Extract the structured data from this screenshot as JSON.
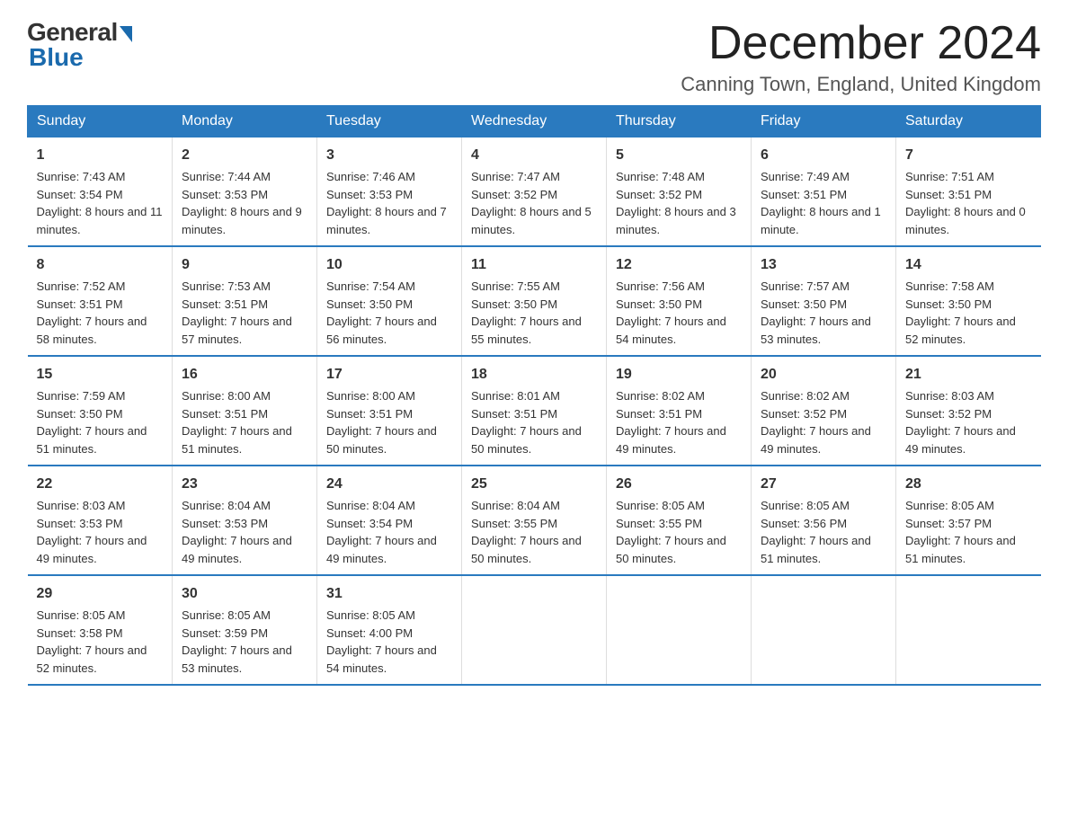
{
  "logo": {
    "general": "General",
    "blue": "Blue"
  },
  "title": "December 2024",
  "subtitle": "Canning Town, England, United Kingdom",
  "weekdays": [
    "Sunday",
    "Monday",
    "Tuesday",
    "Wednesday",
    "Thursday",
    "Friday",
    "Saturday"
  ],
  "weeks": [
    [
      {
        "day": "1",
        "sunrise": "7:43 AM",
        "sunset": "3:54 PM",
        "daylight": "8 hours and 11 minutes."
      },
      {
        "day": "2",
        "sunrise": "7:44 AM",
        "sunset": "3:53 PM",
        "daylight": "8 hours and 9 minutes."
      },
      {
        "day": "3",
        "sunrise": "7:46 AM",
        "sunset": "3:53 PM",
        "daylight": "8 hours and 7 minutes."
      },
      {
        "day": "4",
        "sunrise": "7:47 AM",
        "sunset": "3:52 PM",
        "daylight": "8 hours and 5 minutes."
      },
      {
        "day": "5",
        "sunrise": "7:48 AM",
        "sunset": "3:52 PM",
        "daylight": "8 hours and 3 minutes."
      },
      {
        "day": "6",
        "sunrise": "7:49 AM",
        "sunset": "3:51 PM",
        "daylight": "8 hours and 1 minute."
      },
      {
        "day": "7",
        "sunrise": "7:51 AM",
        "sunset": "3:51 PM",
        "daylight": "8 hours and 0 minutes."
      }
    ],
    [
      {
        "day": "8",
        "sunrise": "7:52 AM",
        "sunset": "3:51 PM",
        "daylight": "7 hours and 58 minutes."
      },
      {
        "day": "9",
        "sunrise": "7:53 AM",
        "sunset": "3:51 PM",
        "daylight": "7 hours and 57 minutes."
      },
      {
        "day": "10",
        "sunrise": "7:54 AM",
        "sunset": "3:50 PM",
        "daylight": "7 hours and 56 minutes."
      },
      {
        "day": "11",
        "sunrise": "7:55 AM",
        "sunset": "3:50 PM",
        "daylight": "7 hours and 55 minutes."
      },
      {
        "day": "12",
        "sunrise": "7:56 AM",
        "sunset": "3:50 PM",
        "daylight": "7 hours and 54 minutes."
      },
      {
        "day": "13",
        "sunrise": "7:57 AM",
        "sunset": "3:50 PM",
        "daylight": "7 hours and 53 minutes."
      },
      {
        "day": "14",
        "sunrise": "7:58 AM",
        "sunset": "3:50 PM",
        "daylight": "7 hours and 52 minutes."
      }
    ],
    [
      {
        "day": "15",
        "sunrise": "7:59 AM",
        "sunset": "3:50 PM",
        "daylight": "7 hours and 51 minutes."
      },
      {
        "day": "16",
        "sunrise": "8:00 AM",
        "sunset": "3:51 PM",
        "daylight": "7 hours and 51 minutes."
      },
      {
        "day": "17",
        "sunrise": "8:00 AM",
        "sunset": "3:51 PM",
        "daylight": "7 hours and 50 minutes."
      },
      {
        "day": "18",
        "sunrise": "8:01 AM",
        "sunset": "3:51 PM",
        "daylight": "7 hours and 50 minutes."
      },
      {
        "day": "19",
        "sunrise": "8:02 AM",
        "sunset": "3:51 PM",
        "daylight": "7 hours and 49 minutes."
      },
      {
        "day": "20",
        "sunrise": "8:02 AM",
        "sunset": "3:52 PM",
        "daylight": "7 hours and 49 minutes."
      },
      {
        "day": "21",
        "sunrise": "8:03 AM",
        "sunset": "3:52 PM",
        "daylight": "7 hours and 49 minutes."
      }
    ],
    [
      {
        "day": "22",
        "sunrise": "8:03 AM",
        "sunset": "3:53 PM",
        "daylight": "7 hours and 49 minutes."
      },
      {
        "day": "23",
        "sunrise": "8:04 AM",
        "sunset": "3:53 PM",
        "daylight": "7 hours and 49 minutes."
      },
      {
        "day": "24",
        "sunrise": "8:04 AM",
        "sunset": "3:54 PM",
        "daylight": "7 hours and 49 minutes."
      },
      {
        "day": "25",
        "sunrise": "8:04 AM",
        "sunset": "3:55 PM",
        "daylight": "7 hours and 50 minutes."
      },
      {
        "day": "26",
        "sunrise": "8:05 AM",
        "sunset": "3:55 PM",
        "daylight": "7 hours and 50 minutes."
      },
      {
        "day": "27",
        "sunrise": "8:05 AM",
        "sunset": "3:56 PM",
        "daylight": "7 hours and 51 minutes."
      },
      {
        "day": "28",
        "sunrise": "8:05 AM",
        "sunset": "3:57 PM",
        "daylight": "7 hours and 51 minutes."
      }
    ],
    [
      {
        "day": "29",
        "sunrise": "8:05 AM",
        "sunset": "3:58 PM",
        "daylight": "7 hours and 52 minutes."
      },
      {
        "day": "30",
        "sunrise": "8:05 AM",
        "sunset": "3:59 PM",
        "daylight": "7 hours and 53 minutes."
      },
      {
        "day": "31",
        "sunrise": "8:05 AM",
        "sunset": "4:00 PM",
        "daylight": "7 hours and 54 minutes."
      },
      null,
      null,
      null,
      null
    ]
  ]
}
